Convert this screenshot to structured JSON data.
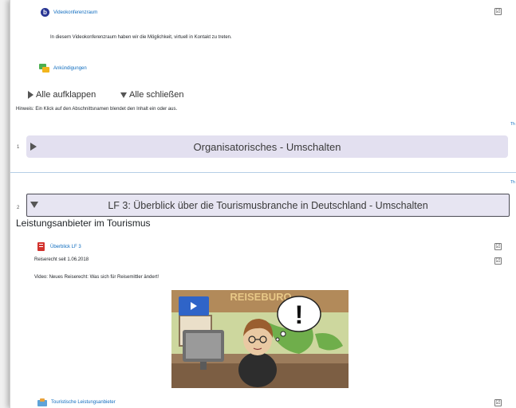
{
  "activities": {
    "video_conference": {
      "label": "Videokonferenzraum",
      "description": "In diesem Videokonferenzraum haben wir die Möglichkeit, virtuell in Kontakt zu treten."
    },
    "announcements": {
      "label": "Ankündigungen"
    }
  },
  "controls": {
    "expand_all": "Alle aufklappen",
    "collapse_all": "Alle schließen",
    "hint": "Hinweis: Ein Klick auf den Abschnittsnamen blendet den Inhalt ein oder aus."
  },
  "edge_text": {
    "a": "Th",
    "b": "Th"
  },
  "sections": [
    {
      "number": "1",
      "title": "Organisatorisches - Umschalten"
    },
    {
      "number": "2",
      "title": "LF 3: Überblick über die Tourismusbranche in Deutschland - Umschalten",
      "subtitle": "Leistungsanbieter im Tourismus"
    }
  ],
  "section2_items": {
    "overview": {
      "label": "Überblick LF 3"
    },
    "travel_law": {
      "label": "Reiserecht seit 1.06.2018"
    },
    "video_caption": "Video: Neues Reiserecht: Was sich für Reisemittler ändert!",
    "video_sign": "REISEBURO",
    "speech_bubble": "!",
    "tourist_providers": {
      "label": "Touristische Leistungsanbieter"
    }
  },
  "checkmark": "☑",
  "colors": {
    "link": "#0f6cbf",
    "section_bg": "#e3e0f0",
    "video_red": "#d2322d"
  }
}
